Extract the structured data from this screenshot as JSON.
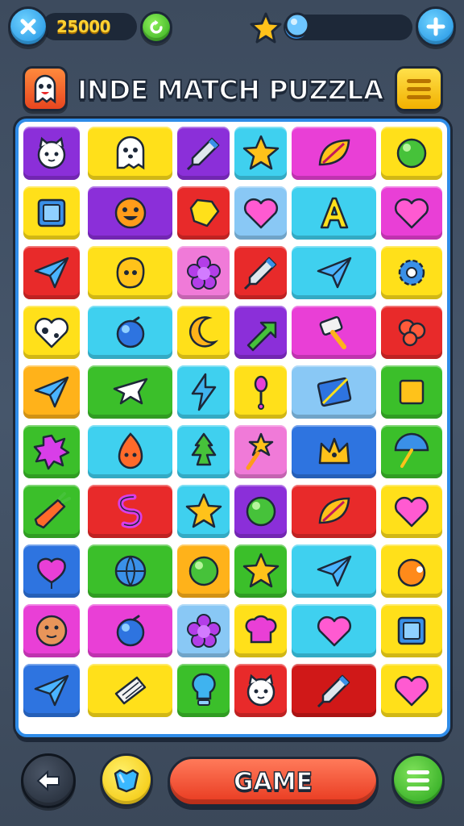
{
  "hud": {
    "coins": "25000",
    "energy_level": 0.05,
    "colors": {
      "accent": "#1b8ee0",
      "coin": "#ffd233",
      "panel": "#1d2838"
    }
  },
  "title": {
    "text": "INDE MATCH PUZZLA"
  },
  "bottom": {
    "primary_label": "GAME"
  },
  "board": {
    "rows": [
      [
        {
          "icon": "cat-face-icon",
          "color": "#8b2fd9"
        },
        {
          "icon": "ghost-icon",
          "color": "#ffe01a"
        },
        {
          "icon": "rocket-icon",
          "color": "#8b2fd9"
        },
        {
          "icon": "star-icon",
          "color": "#3fd0ef"
        },
        {
          "icon": "leaf-icon",
          "color": "#e93fd6"
        },
        {
          "icon": "ball-icon",
          "color": "#ffe01a"
        }
      ],
      [
        {
          "icon": "square-frame-icon",
          "color": "#ffe01a"
        },
        {
          "icon": "smiley-icon",
          "color": "#8b2fd9"
        },
        {
          "icon": "gem-icon",
          "color": "#e82a2a"
        },
        {
          "icon": "heart-icon",
          "color": "#89c8f5"
        },
        {
          "icon": "letter-a-icon",
          "color": "#3fd0ef"
        },
        {
          "icon": "heart-icon",
          "color": "#e93fd6"
        }
      ],
      [
        {
          "icon": "paper-plane-icon",
          "color": "#e82a2a"
        },
        {
          "icon": "blob-face-icon",
          "color": "#ffe01a"
        },
        {
          "icon": "flower-icon",
          "color": "#f07ad8"
        },
        {
          "icon": "rocket-icon",
          "color": "#e82a2a"
        },
        {
          "icon": "paper-plane-icon",
          "color": "#3fd0ef"
        },
        {
          "icon": "gear-icon",
          "color": "#ffe01a"
        }
      ],
      [
        {
          "icon": "heart-cow-icon",
          "color": "#ffe01a"
        },
        {
          "icon": "orb-icon",
          "color": "#3fd0ef"
        },
        {
          "icon": "moon-icon",
          "color": "#ffe01a"
        },
        {
          "icon": "arrow-icon",
          "color": "#8b2fd9"
        },
        {
          "icon": "hammer-icon",
          "color": "#e93fd6"
        },
        {
          "icon": "knot-icon",
          "color": "#e82a2a"
        }
      ],
      [
        {
          "icon": "paper-plane-icon",
          "color": "#ffb21a"
        },
        {
          "icon": "bird-icon",
          "color": "#3bbf2a"
        },
        {
          "icon": "lightning-icon",
          "color": "#3fd0ef"
        },
        {
          "icon": "pin-icon",
          "color": "#ffe01a"
        },
        {
          "icon": "panel-icon",
          "color": "#89c8f5"
        },
        {
          "icon": "square-icon",
          "color": "#3bbf2a"
        }
      ],
      [
        {
          "icon": "splat-icon",
          "color": "#3bbf2a"
        },
        {
          "icon": "fire-face-icon",
          "color": "#3fd0ef"
        },
        {
          "icon": "tree-icon",
          "color": "#3fd0ef"
        },
        {
          "icon": "wand-icon",
          "color": "#f07ad8"
        },
        {
          "icon": "crown-icon",
          "color": "#2e74e0"
        },
        {
          "icon": "umbrella-icon",
          "color": "#3bbf2a"
        }
      ],
      [
        {
          "icon": "carrot-icon",
          "color": "#3bbf2a"
        },
        {
          "icon": "swirl-icon",
          "color": "#e82a2a"
        },
        {
          "icon": "star-icon",
          "color": "#3fd0ef"
        },
        {
          "icon": "ball-icon",
          "color": "#8b2fd9"
        },
        {
          "icon": "leaf-icon",
          "color": "#e82a2a"
        },
        {
          "icon": "heart-icon",
          "color": "#ffe01a"
        }
      ],
      [
        {
          "icon": "balloon-icon",
          "color": "#2e74e0"
        },
        {
          "icon": "globe-icon",
          "color": "#3bbf2a"
        },
        {
          "icon": "ball-icon",
          "color": "#ffb21a"
        },
        {
          "icon": "star-icon",
          "color": "#3bbf2a"
        },
        {
          "icon": "paper-plane-icon",
          "color": "#3fd0ef"
        },
        {
          "icon": "orange-icon",
          "color": "#ffe01a"
        }
      ],
      [
        {
          "icon": "cookie-face-icon",
          "color": "#e93fd6"
        },
        {
          "icon": "orb-icon",
          "color": "#e93fd6"
        },
        {
          "icon": "flower-icon",
          "color": "#89c8f5"
        },
        {
          "icon": "chef-hat-icon",
          "color": "#ffe01a"
        },
        {
          "icon": "heart-icon",
          "color": "#3fd0ef"
        },
        {
          "icon": "square-frame-icon",
          "color": "#ffe01a"
        }
      ],
      [
        {
          "icon": "paper-plane-icon",
          "color": "#2e74e0"
        },
        {
          "icon": "notebook-icon",
          "color": "#ffe01a"
        },
        {
          "icon": "bulb-icon",
          "color": "#3bbf2a"
        },
        {
          "icon": "cat-face-icon",
          "color": "#e82a2a"
        },
        {
          "icon": "rocket-icon",
          "color": "#d01818"
        },
        {
          "icon": "heart-icon",
          "color": "#ffe01a"
        }
      ]
    ]
  }
}
